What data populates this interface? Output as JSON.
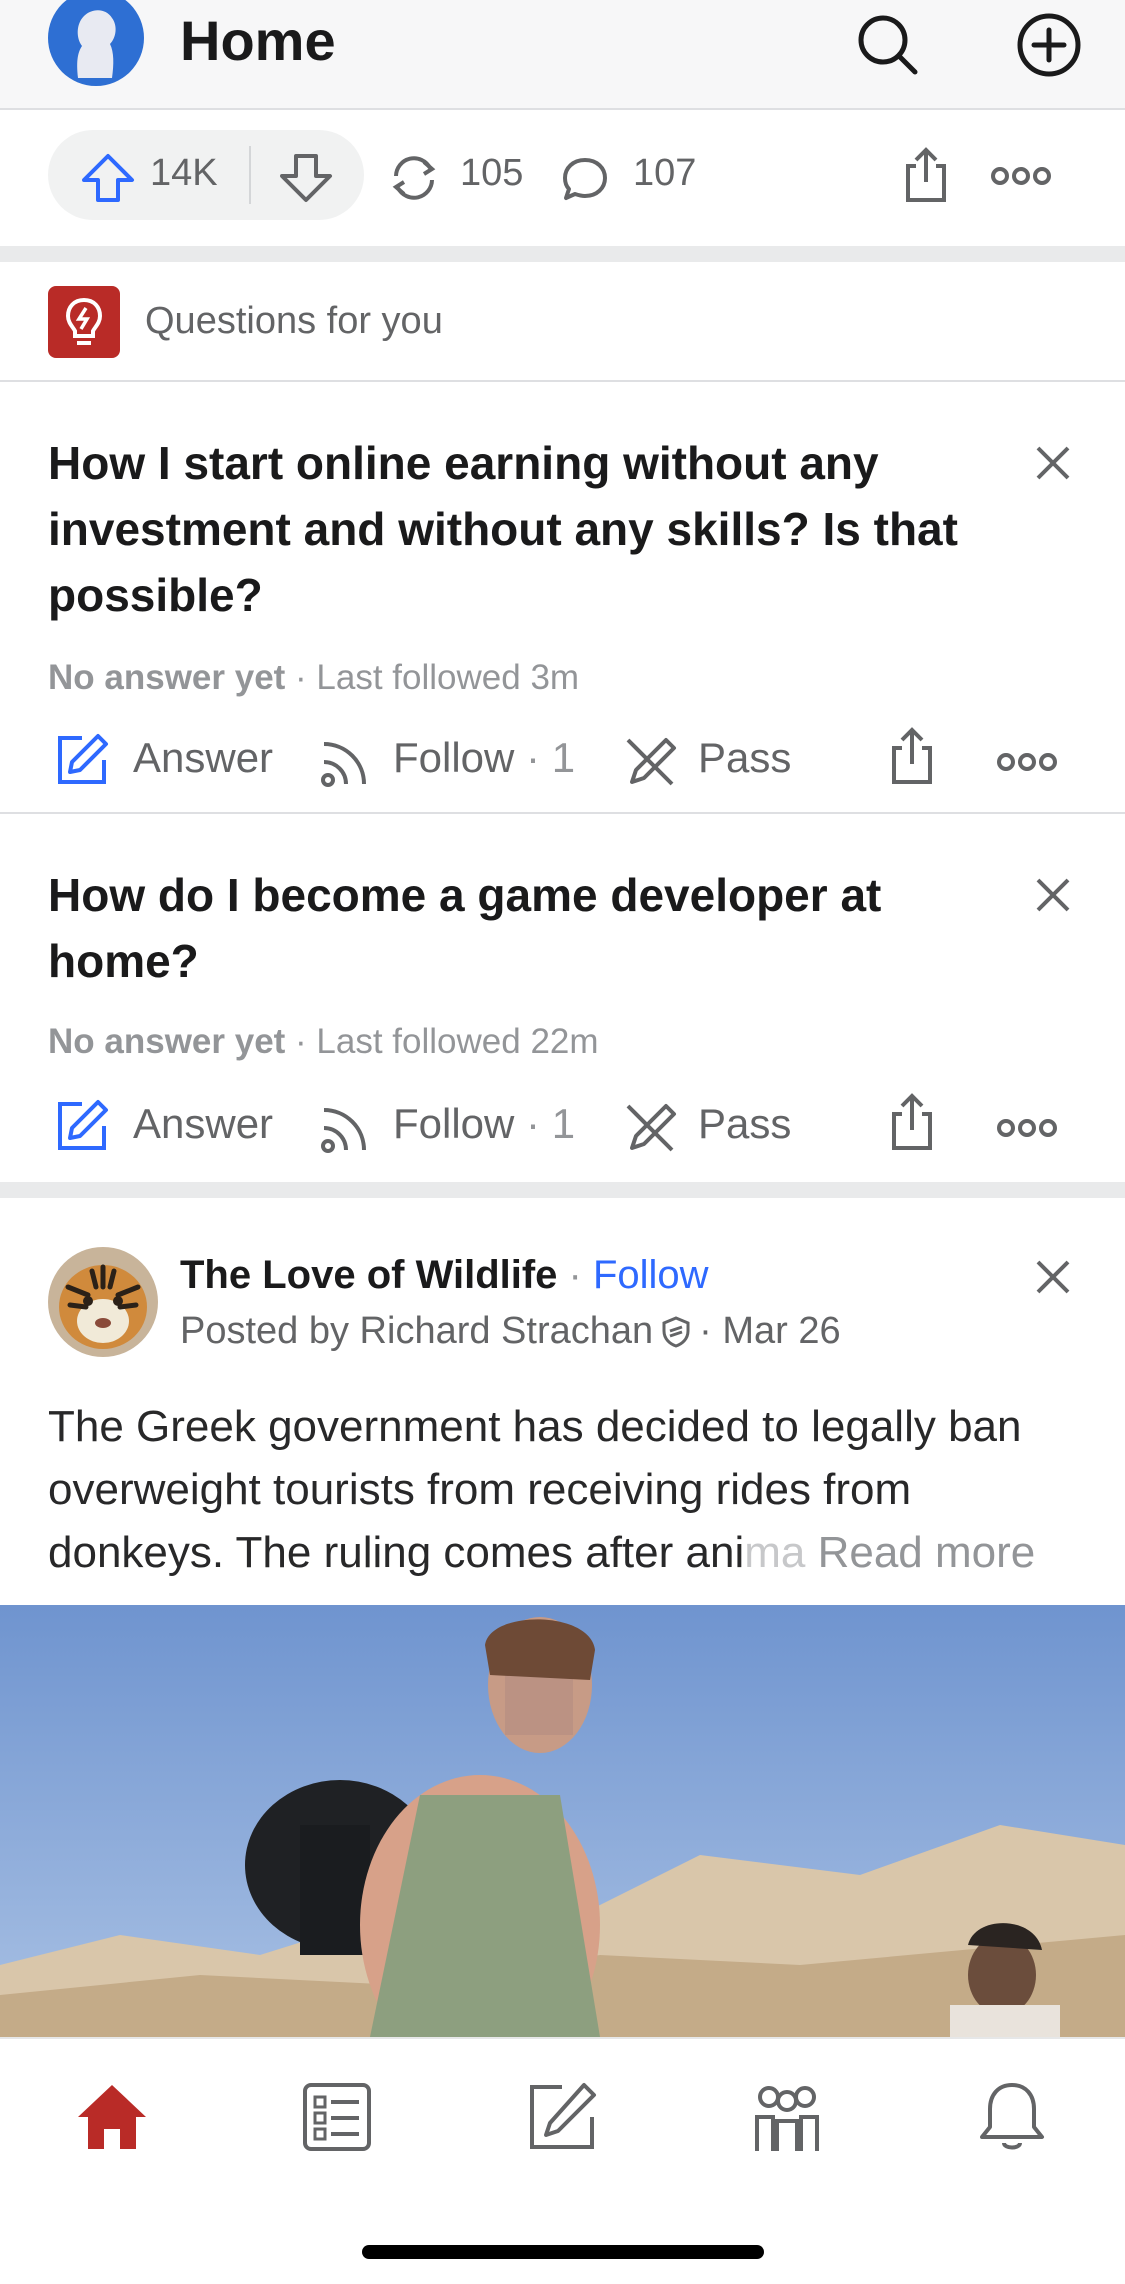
{
  "header": {
    "title": "Home"
  },
  "vote_bar": {
    "upvotes": "14K",
    "reshares": "105",
    "comments": "107"
  },
  "questions_section": {
    "label": "Questions for you"
  },
  "questions": [
    {
      "title": "How I start online earning without any investment and without any skills? Is that possible?",
      "status": "No answer yet",
      "last_followed": "· Last followed 3m",
      "answer_label": "Answer",
      "follow_label": "Follow",
      "follow_count": "· 1",
      "pass_label": "Pass"
    },
    {
      "title": "How do I become a game developer at home?",
      "status": "No answer yet",
      "last_followed": "· Last followed 22m",
      "answer_label": "Answer",
      "follow_label": "Follow",
      "follow_count": "· 1",
      "pass_label": "Pass"
    }
  ],
  "post": {
    "space_name": "The Love of Wildlife",
    "dot": " · ",
    "follow_label": "Follow",
    "posted_by": "Posted by Richard Strachan",
    "date": "· Mar 26",
    "body_main": "The Greek government has decided to legally ban overweight tourists from receiving rides from donkeys. The ruling comes after ani",
    "body_faded": "ma",
    "read_more": "Read more"
  },
  "colors": {
    "brand_red": "#b92b27",
    "link_blue": "#2e69ff",
    "text_dark": "#282829",
    "text_muted": "#636466"
  },
  "icons": [
    "profile-avatar-icon",
    "search-icon",
    "add-circle-icon",
    "upvote-icon",
    "downvote-icon",
    "reshare-icon",
    "comment-icon",
    "share-icon",
    "more-icon",
    "lightbulb-icon",
    "close-icon",
    "answer-pencil-icon",
    "follow-rss-icon",
    "pass-icon",
    "shield-icon",
    "home-icon",
    "following-icon",
    "write-icon",
    "spaces-icon",
    "notifications-icon"
  ]
}
